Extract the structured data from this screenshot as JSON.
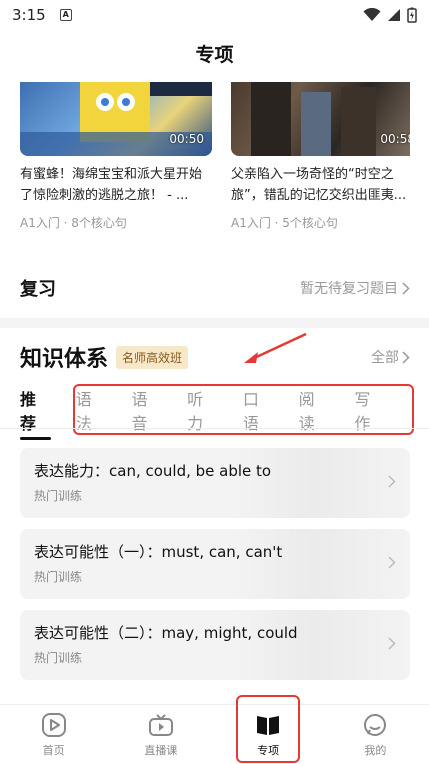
{
  "status": {
    "time": "3:15",
    "sim": "A"
  },
  "header": {
    "title": "专项"
  },
  "videos": [
    {
      "title": "有蜜蜂！海绵宝宝和派大星开始了惊险刺激的逃脱之旅！ - ...",
      "duration": "00:50",
      "meta": "A1入门 · 8个核心句"
    },
    {
      "title": "父亲陷入一场奇怪的“时空之旅”，错乱的记忆交织出匪夷...",
      "duration": "00:58",
      "meta": "A1入门 · 5个核心句"
    }
  ],
  "review": {
    "label": "复习",
    "status": "暂无待复习题目"
  },
  "knowledge": {
    "title": "知识体系",
    "badge": "名师高效班",
    "all": "全部",
    "tabs": [
      "推荐",
      "语法",
      "语音",
      "听力",
      "口语",
      "阅读",
      "写作"
    ],
    "cards": [
      {
        "title": "表达能力：can, could, be able to",
        "sub": "热门训练"
      },
      {
        "title": "表达可能性（一）：must, can, can't",
        "sub": "热门训练"
      },
      {
        "title": "表达可能性（二）：may, might, could",
        "sub": "热门训练"
      }
    ]
  },
  "nav": [
    {
      "label": "首页",
      "icon": "play-circle-icon"
    },
    {
      "label": "直播课",
      "icon": "tv-icon"
    },
    {
      "label": "专项",
      "icon": "book-icon"
    },
    {
      "label": "我的",
      "icon": "profile-face-icon"
    }
  ],
  "colors": {
    "annotation": "#e53935",
    "badge_bg": "#f6e8c9",
    "badge_text": "#8a5a1a"
  }
}
